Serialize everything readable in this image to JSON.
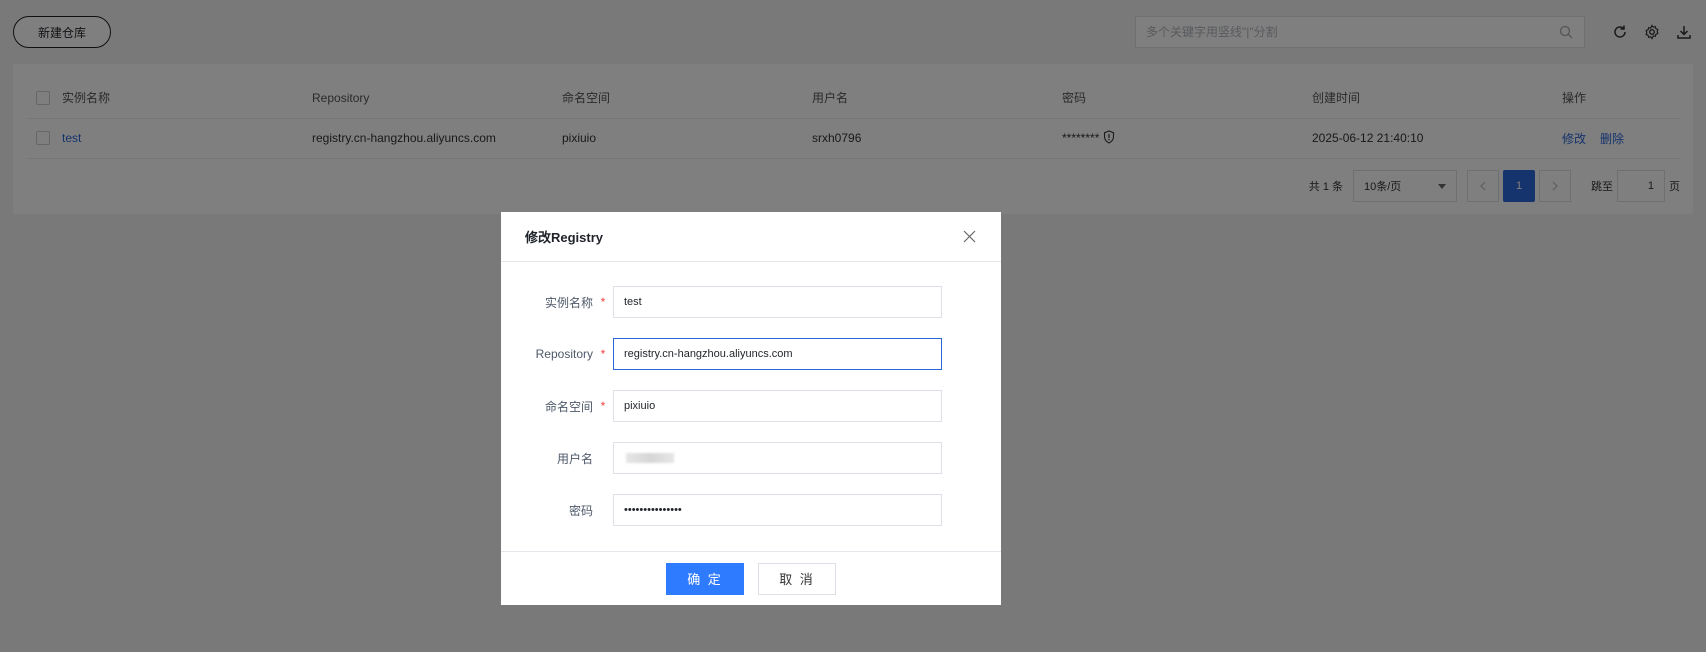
{
  "toolbar": {
    "new_button": "新建仓库",
    "search_placeholder": "多个关键字用竖线\"|\"分割"
  },
  "icons": {
    "search": "search-icon",
    "refresh": "refresh-icon",
    "settings": "gear-icon",
    "download": "download-icon",
    "password_toggle": "shield-icon",
    "close": "close-icon"
  },
  "table": {
    "headers": [
      "实例名称",
      "Repository",
      "命名空间",
      "用户名",
      "密码",
      "创建时间",
      "操作"
    ],
    "rows": [
      {
        "name": "test",
        "repository": "registry.cn-hangzhou.aliyuncs.com",
        "namespace": "pixiuio",
        "username": "srxh0796",
        "password": "********",
        "created": "2025-06-12 21:40:10",
        "edit": "修改",
        "delete": "删除"
      }
    ]
  },
  "pagination": {
    "total": "共 1 条",
    "page_size": "10条/页",
    "current": "1",
    "jump_label": "跳至",
    "jump_value": "1",
    "page_unit": "页"
  },
  "dialog": {
    "title": "修改Registry",
    "fields": {
      "name": {
        "label": "实例名称",
        "required": "*",
        "value": "test"
      },
      "repository": {
        "label": "Repository",
        "required": "*",
        "value": "registry.cn-hangzhou.aliyuncs.com"
      },
      "namespace": {
        "label": "命名空间",
        "required": "*",
        "value": "pixiuio"
      },
      "username": {
        "label": "用户名",
        "value": ""
      },
      "password": {
        "label": "密码",
        "value": "•••••••••••••••"
      }
    },
    "ok": "确 定",
    "cancel": "取 消"
  },
  "colors": {
    "primary": "#2b66d9",
    "button_ok": "#2f7bff",
    "required": "#f53f3f"
  }
}
